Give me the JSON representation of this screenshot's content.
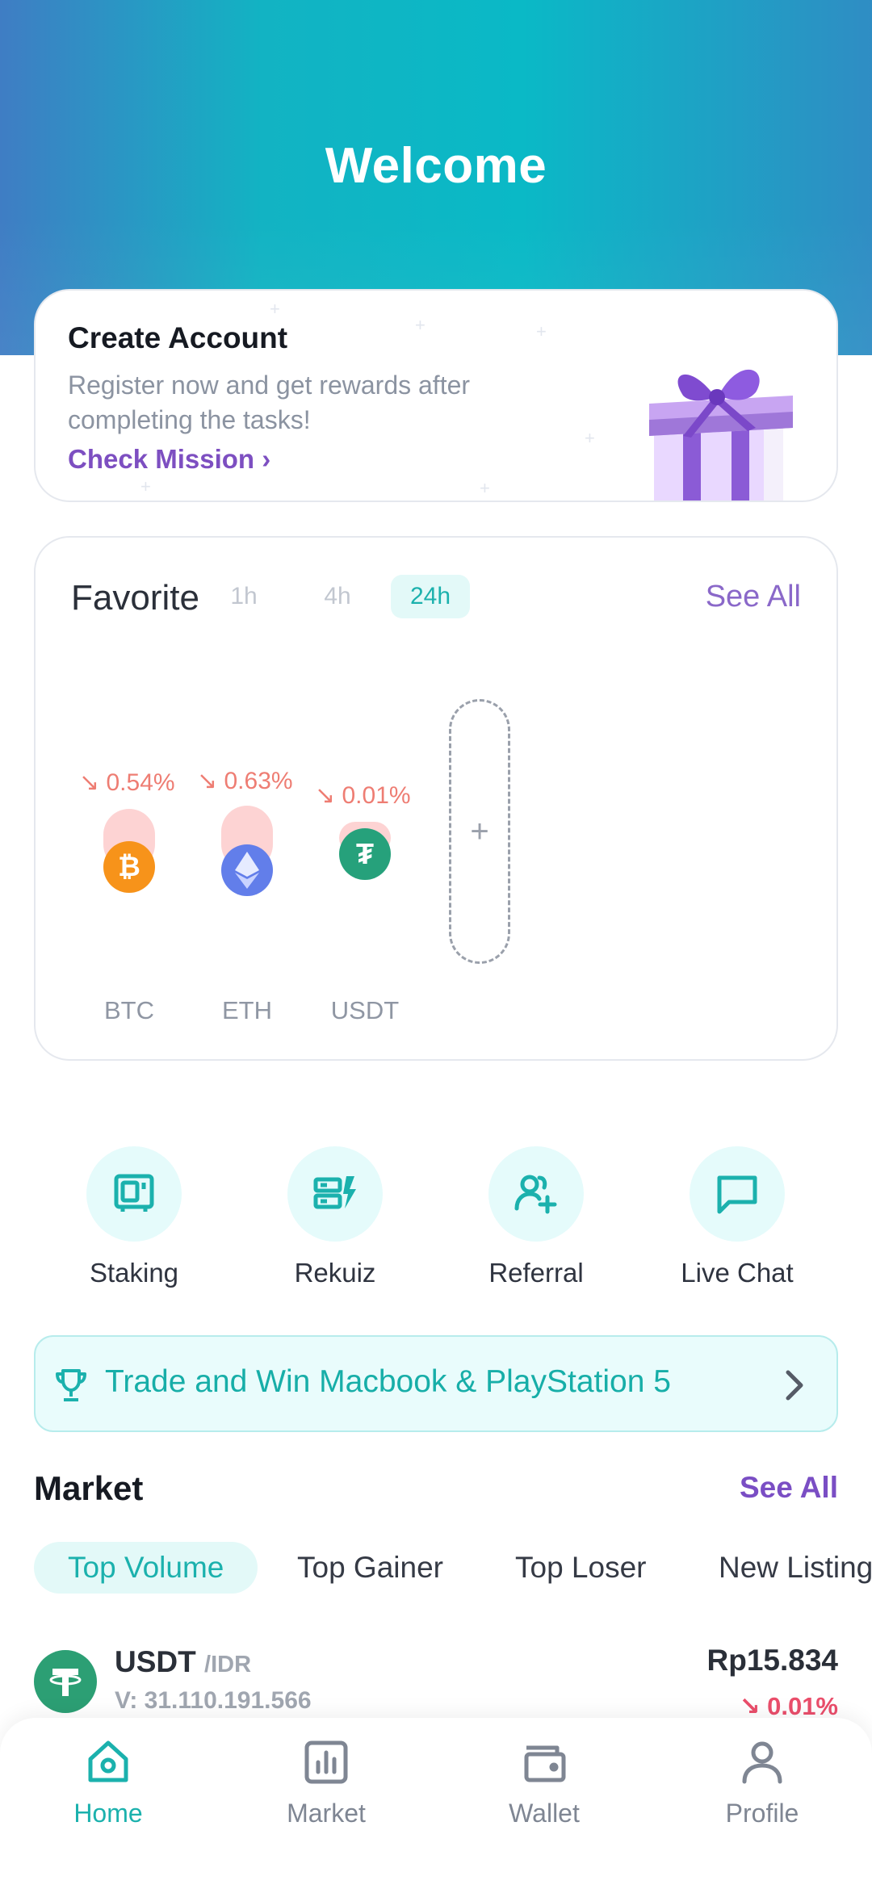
{
  "header": {
    "title": "Welcome"
  },
  "create_account": {
    "title": "Create Account",
    "description": "Register now and get rewards after completing the tasks!",
    "link": "Check Mission ›"
  },
  "favorite": {
    "title": "Favorite",
    "timeframes": [
      "1h",
      "4h",
      "24h"
    ],
    "active_timeframe": "24h",
    "see_all": "See All",
    "add_symbol": "+",
    "coins": [
      {
        "symbol": "BTC",
        "change": "0.54%",
        "direction": "down"
      },
      {
        "symbol": "ETH",
        "change": "0.63%",
        "direction": "down"
      },
      {
        "symbol": "USDT",
        "change": "0.01%",
        "direction": "down"
      }
    ]
  },
  "shortcuts": [
    {
      "label": "Staking",
      "icon": "safe-box-icon"
    },
    {
      "label": "Rekuiz",
      "icon": "quiz-icon"
    },
    {
      "label": "Referral",
      "icon": "add-user-icon"
    },
    {
      "label": "Live Chat",
      "icon": "chat-bubble-icon"
    }
  ],
  "promo": {
    "text": "Trade and Win Macbook & PlayStation 5"
  },
  "market": {
    "title": "Market",
    "see_all": "See All",
    "tabs": [
      "Top Volume",
      "Top Gainer",
      "Top Loser",
      "New Listing"
    ],
    "active_tab": "Top Volume",
    "rows": [
      {
        "symbol": "USDT",
        "pair": "/IDR",
        "volume": "V: 31.110.191.566",
        "price": "Rp15.834",
        "change": "0.01%",
        "direction": "down"
      }
    ]
  },
  "nav": {
    "items": [
      {
        "label": "Home",
        "icon": "home-icon",
        "active": true
      },
      {
        "label": "Market",
        "icon": "bar-chart-icon",
        "active": false
      },
      {
        "label": "Wallet",
        "icon": "wallet-icon",
        "active": false
      },
      {
        "label": "Profile",
        "icon": "person-icon",
        "active": false
      }
    ]
  },
  "colors": {
    "accent_teal": "#1bb1ad",
    "accent_purple": "#7d4fc1",
    "down_red": "#ea4e6b",
    "btc_orange": "#f7931a",
    "eth_blue": "#627eea",
    "usdt_green": "#26a17b"
  }
}
